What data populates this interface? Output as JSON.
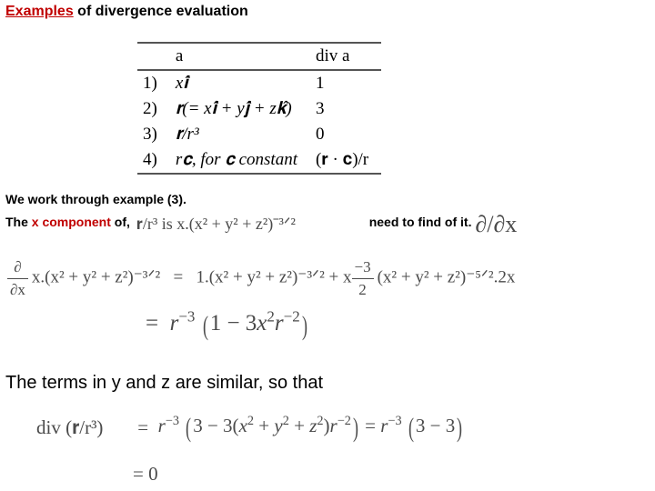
{
  "title": {
    "highlight": "Examples",
    "rest": " of divergence evaluation"
  },
  "table": {
    "head_a": "a",
    "head_div": "div a",
    "rows": [
      {
        "n": "1)",
        "a": "x𝐢̂",
        "div": "1"
      },
      {
        "n": "2)",
        "a": "𝐫(= x𝐢̂ + y𝐣̂ + z𝐤̂)",
        "div": "3"
      },
      {
        "n": "3)",
        "a": "𝐫/r³",
        "div": "0"
      },
      {
        "n": "4)",
        "a": "r𝐜, for 𝐜 constant",
        "div": "(𝐫 · 𝐜)/r"
      }
    ]
  },
  "para": {
    "line1": "We work through example (3).",
    "line2a": "The ",
    "line2_red": "x component",
    "line2b": " of, ",
    "line2_math": "𝐫/r³ is x.(x² + y² + z²)⁻³ᐟ²",
    "line2c": " need to find of  it. ",
    "line2_partial": "∂/∂x"
  },
  "eq1": {
    "fnum": "∂",
    "fden": "∂x",
    "lhs": "x.(x² + y² + z²)⁻³ᐟ²",
    "eq": "=",
    "rhs_a": "1.(x² + y² + z²)⁻³ᐟ² + x",
    "rhs_fnum": "−3",
    "rhs_fden": "2",
    "rhs_b": "(x² + y² + z²)⁻⁵ᐟ².2x",
    "line2": "=  r⁻³ (1 − 3x²r⁻²)"
  },
  "stmt": "The terms in y and z are similar, so that",
  "eq2": {
    "lhs": "div (𝐫/r³)",
    "eq": "=",
    "rhs": "r⁻³ (3 − 3(x² + y² + z²)r⁻²) = r⁻³ (3 − 3)",
    "line2_lhs": "",
    "line2": "=   0"
  }
}
